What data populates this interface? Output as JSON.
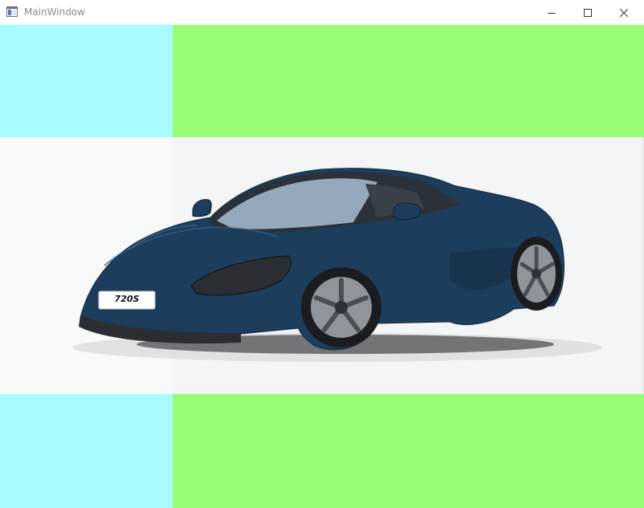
{
  "window": {
    "title": "MainWindow"
  },
  "controls": {
    "minimize_icon": "minimize-icon",
    "maximize_icon": "maximize-icon",
    "close_icon": "close-icon"
  },
  "panels": {
    "top_left_color": "#a8fcff",
    "top_right_color": "#97fe76",
    "bottom_left_color": "#a8fcff",
    "bottom_right_color": "#97fe76"
  },
  "image": {
    "subject": "car-image",
    "license_plate_text": "720S",
    "car_color": "#1d3d5c"
  }
}
